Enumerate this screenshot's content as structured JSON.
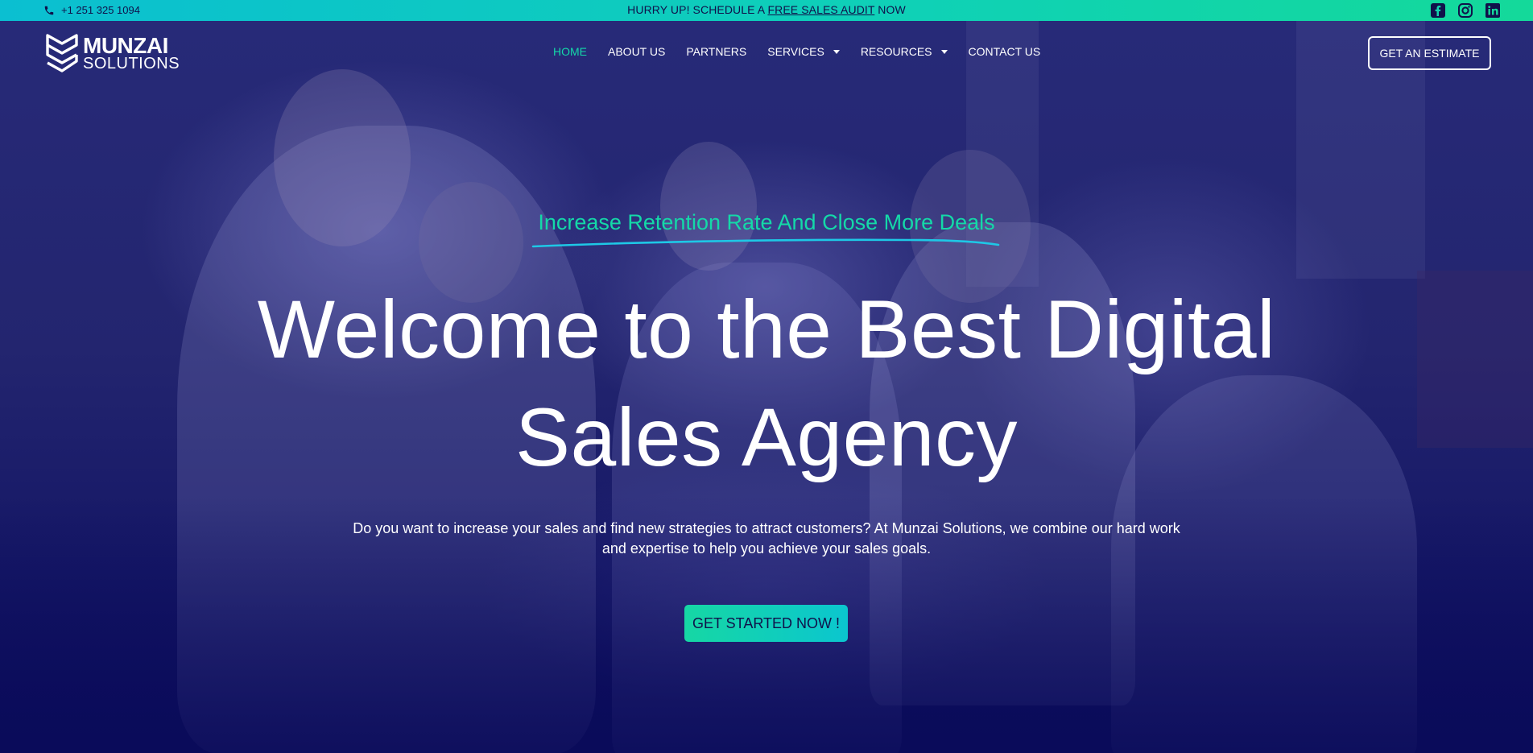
{
  "topbar": {
    "phone": "+1 251 325 1094",
    "promo_prefix": "HURRY UP! SCHEDULE A ",
    "promo_link": "FREE SALES AUDIT",
    "promo_suffix": " NOW",
    "social_icons": [
      "facebook-icon",
      "instagram-icon",
      "linkedin-icon"
    ]
  },
  "header": {
    "logo_line1": "MUNZAI",
    "logo_line2": "SOLUTIONS",
    "nav": [
      {
        "label": "HOME",
        "active": true
      },
      {
        "label": "ABOUT US"
      },
      {
        "label": "PARTNERS"
      },
      {
        "label": "SERVICES",
        "dropdown": true
      },
      {
        "label": "RESOURCES",
        "dropdown": true
      },
      {
        "label": "CONTACT US"
      }
    ],
    "estimate_button": "GET AN ESTIMATE"
  },
  "hero": {
    "tagline": "Increase Retention Rate And Close More Deals",
    "title_line1": "Welcome to the Best Digital",
    "title_line2": "Sales Agency",
    "description_line1": "Do you want to increase your sales and find new strategies to attract customers? At Munzai Solutions, we combine our hard work",
    "description_line2": "and expertise to help you achieve your sales goals.",
    "cta": "GET STARTED NOW !"
  },
  "colors": {
    "accent": "#14d9a8",
    "topbar_gradient_start": "#0bbfd1",
    "topbar_gradient_end": "#14d99a",
    "hero_overlay": "#1c1e6e",
    "text_dark": "#10114a"
  }
}
